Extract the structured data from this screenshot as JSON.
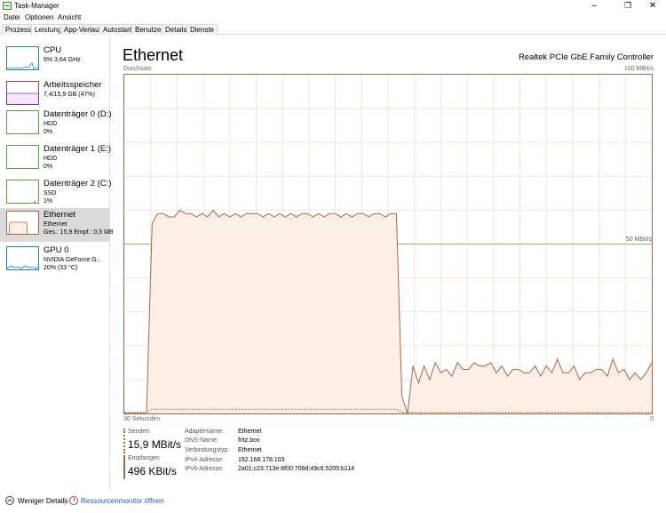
{
  "window": {
    "title": "Task-Manager",
    "minimize": "–",
    "maximize": "❐",
    "close": "✕"
  },
  "menu": [
    "Datei",
    "Optionen",
    "Ansicht"
  ],
  "tabs": [
    "Prozesse",
    "Leistung",
    "App-Verlauf",
    "Autostart",
    "Benutzer",
    "Details",
    "Dienste"
  ],
  "active_tab": "Leistung",
  "sidebar": [
    {
      "name": "CPU",
      "sub1": "6% 3,64 GHz",
      "sub2": "",
      "color": "#1f7fc4",
      "fill": "#e6f1fa"
    },
    {
      "name": "Arbeitsspeicher",
      "sub1": "7,4/15,9 GB (47%)",
      "sub2": "",
      "color": "#8b2ea5",
      "fill": "#f4e8f8"
    },
    {
      "name": "Datenträger 0 (D:)",
      "sub1": "HDD",
      "sub2": "0%",
      "color": "#4caa3a",
      "fill": "#eef7ec"
    },
    {
      "name": "Datenträger 1 (E:)",
      "sub1": "HDD",
      "sub2": "0%",
      "color": "#4caa3a",
      "fill": "#eef7ec"
    },
    {
      "name": "Datenträger 2 (C:)",
      "sub1": "SSD",
      "sub2": "1%",
      "color": "#4caa3a",
      "fill": "#eef7ec"
    },
    {
      "name": "Ethernet",
      "sub1": "Ethernet",
      "sub2": "Ges.: 15,9 Empf.: 0,5 MB",
      "color": "#a0694b",
      "fill": "#fbeee4"
    },
    {
      "name": "GPU 0",
      "sub1": "NVIDIA GeForce G...",
      "sub2": "20% (33 °C)",
      "color": "#1f7fc4",
      "fill": "#e6f1fa"
    }
  ],
  "main": {
    "title": "Ethernet",
    "adapter": "Realtek PCIe GbE Family Controller",
    "graph_label": "Durchsatz",
    "max_label": "100 MBit/s",
    "mid_label": "50 MBit/s",
    "time_label": "30 Sekunden",
    "zero_label": "0",
    "accent": "#a0694b",
    "grid_color": "#f3e3d6",
    "fill_color": "#fbeee4"
  },
  "graph_series": {
    "send": [
      0,
      0,
      0,
      0,
      0,
      0,
      0,
      0,
      0,
      0,
      0,
      0,
      0,
      0,
      0,
      0,
      0,
      0,
      0,
      0,
      0,
      0,
      0,
      0,
      0,
      0,
      0,
      0,
      0,
      0,
      0,
      0,
      0,
      0,
      0,
      0,
      0,
      0,
      0,
      0,
      0,
      0,
      0,
      0,
      0,
      0,
      0,
      0,
      0,
      0,
      0,
      0,
      0,
      0,
      0,
      0,
      0,
      0,
      0,
      0,
      0,
      0,
      0,
      0,
      0,
      0,
      0,
      0,
      0,
      0,
      0,
      0,
      0,
      0,
      0,
      0,
      0,
      0,
      0,
      0,
      0,
      0,
      0,
      0,
      0,
      0,
      0,
      0,
      0,
      0,
      0,
      0,
      0,
      0,
      0,
      0,
      0,
      0,
      0,
      0
    ],
    "send_values": [
      0,
      0,
      0,
      0,
      0,
      56,
      59,
      59,
      58,
      58,
      60,
      59,
      59,
      58,
      59,
      58,
      60,
      58,
      59,
      58,
      59,
      58,
      59,
      59,
      59,
      58,
      59,
      58,
      59,
      58,
      59,
      58,
      59,
      59,
      58,
      59,
      58,
      59,
      59,
      58,
      59,
      58,
      59,
      59,
      58,
      59,
      59,
      58,
      59,
      59,
      5,
      0,
      14,
      9,
      14,
      10,
      15,
      12,
      13,
      11,
      15,
      13,
      13,
      15,
      14,
      14,
      15,
      12,
      14,
      11,
      13,
      13,
      12,
      12,
      14,
      11,
      14,
      12,
      16,
      12,
      12,
      14,
      10,
      12,
      12,
      13,
      13,
      11,
      16,
      12,
      13,
      10,
      12,
      10,
      12,
      15
    ],
    "recv_values": [
      0,
      0,
      0,
      0,
      0,
      1,
      1,
      1,
      1,
      1,
      1,
      1,
      1,
      1,
      1,
      1,
      1,
      1,
      1,
      1,
      1,
      1,
      1,
      1,
      1,
      1,
      1,
      1,
      1,
      1,
      1,
      1,
      1,
      1,
      1,
      1,
      1,
      1,
      1,
      1,
      1,
      1,
      1,
      1,
      1,
      1,
      1,
      1,
      1,
      1,
      0,
      0,
      0,
      0,
      0,
      0,
      0,
      0,
      0,
      0,
      0,
      0,
      0,
      0,
      0,
      0,
      0,
      0,
      0,
      0,
      0,
      0,
      0,
      0,
      0,
      0,
      0,
      0,
      0,
      0,
      0,
      0,
      0,
      0,
      0,
      0,
      0,
      0,
      0,
      0,
      0,
      0,
      0,
      0,
      0,
      0
    ],
    "y_max": 100
  },
  "stats": {
    "send_label": "Senden",
    "send_value": "15,9 MBit/s",
    "recv_label": "Empfangen",
    "recv_value": "496 KBit/s"
  },
  "info": [
    {
      "key": "Adaptername:",
      "value": "Ethernet"
    },
    {
      "key": "DNS-Name:",
      "value": "fritz.box"
    },
    {
      "key": "Verbindungstyp:",
      "value": "Ethernet"
    },
    {
      "key": "IPv4-Adresse:",
      "value": "192.168.178.103"
    },
    {
      "key": "IPv6-Adresse:",
      "value": "2a01:c23:713e:8f00:708d:49c6:5205:b114"
    }
  ],
  "footer": {
    "fewer_details": "Weniger Details",
    "resource_monitor": "Ressourcenmonitor öffnen"
  }
}
